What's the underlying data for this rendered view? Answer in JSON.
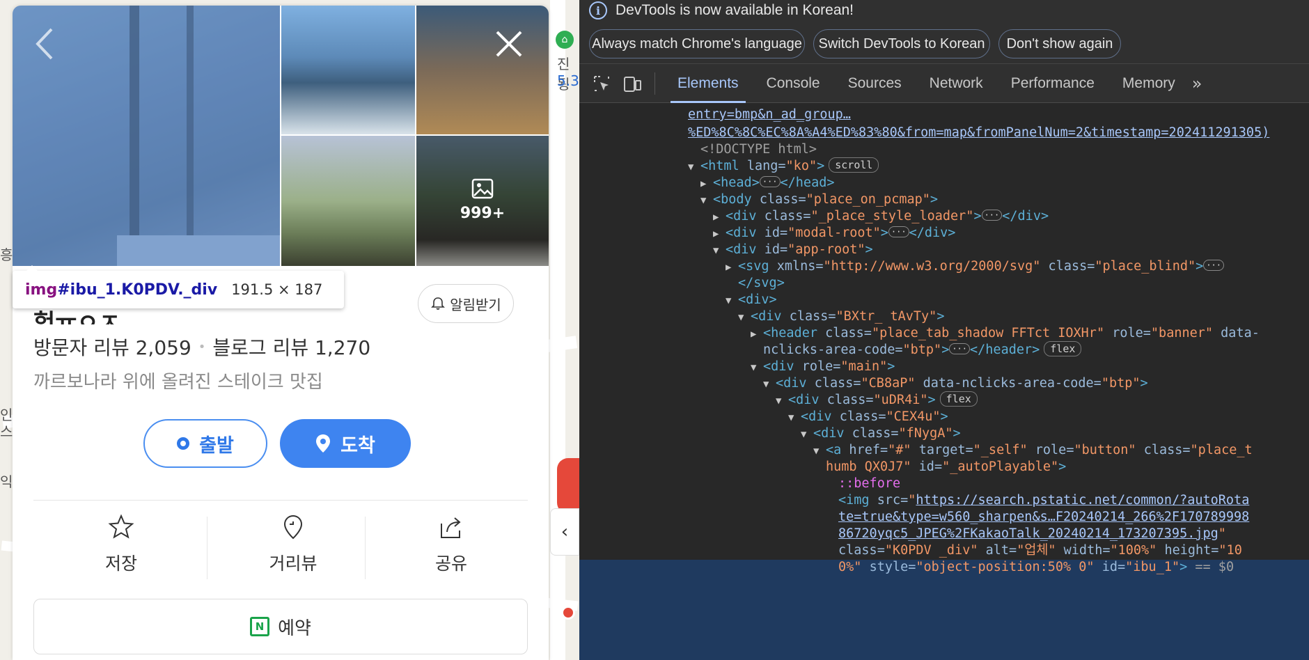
{
  "map": {
    "labels": [
      "진됭",
      "5.3r",
      "인",
      "스",
      "익",
      "흥"
    ]
  },
  "place": {
    "more_photos": "999+",
    "title_partial": "헝ㅠㅇㅈ",
    "alert_label": "알림받기",
    "visitor_review": "방문자 리뷰 2,059",
    "blog_review": "블로그 리뷰 1,270",
    "description": "까르보나라 위에 올려진 스테이크 맛집",
    "start_label": "출발",
    "arrive_label": "도착",
    "actions": {
      "save": "저장",
      "streetview": "거리뷰",
      "share": "공유"
    },
    "reserve_label": "예약",
    "collapse_glyph": "‹"
  },
  "inspector": {
    "tag": "img",
    "selector": "#ibu_1.K0PDV._div",
    "size": "191.5 × 187"
  },
  "devtools": {
    "banner_message": "DevTools is now available in Korean!",
    "banner_buttons": [
      "Always match Chrome's language",
      "Switch DevTools to Korean",
      "Don't show again"
    ],
    "tabs": [
      "Elements",
      "Console",
      "Sources",
      "Network",
      "Performance",
      "Memory"
    ],
    "active_tab": "Elements",
    "overflow": "»",
    "dom": {
      "url1": "entry=bmp&n_ad_group…",
      "url2": "%ED%8C%8C%EC%8A%A4%ED%83%80&from=map&fromPanelNum=2&timestamp=202411291305)",
      "doctype": "<!DOCTYPE html>",
      "html_lang": "\"ko\"",
      "scroll_badge": "scroll",
      "body_class": "\"place_on_pcmap\"",
      "div1_class": "\"_place_style_loader\"",
      "div2_id": "\"modal-root\"",
      "div3_id": "\"app-root\"",
      "svg_xmlns": "\"http://www.w3.org/2000/svg\"",
      "svg_class": "\"place_blind\"",
      "div_bxtr": "\"BXtr_ tAvTy\"",
      "header_class": "\"place_tab_shadow FFTct IOXHr\"",
      "header_role": "\"banner\"",
      "header_rest": "data-",
      "header_line2_attr": "nclicks-area-code=",
      "header_line2_val": "\"btp\"",
      "flex_badge": "flex",
      "main_role": "\"main\"",
      "cb8ap_class": "\"CB8aP\"",
      "cb8ap_attr": "data-nclicks-area-code=",
      "cb8ap_val": "\"btp\"",
      "udr4i_class": "\"uDR4i\"",
      "cex4u_class": "\"CEX4u\"",
      "fnyga_class": "\"fNygA\"",
      "a_href": "\"#\"",
      "a_target": "\"_self\"",
      "a_role": "\"button\"",
      "a_class_start": "\"place_t",
      "a_line2": "humb QX0J7\"",
      "a_id": "\"_autoPlayable\"",
      "before": "::before",
      "img_src1": "https://search.pstatic.net/common/?autoRota",
      "img_src2": "te=true&type=w560_sharpen&s…F20240214_266%2F170789998",
      "img_src3": "86720yqc5_JPEG%2FKakaoTalk_20240214_173207395.jpg",
      "img_class": "\"K0PDV _div\"",
      "img_alt": "\"업체\"",
      "img_width": "\"100%\"",
      "img_height": "\"10",
      "img_line5_start": "0%\"",
      "img_style": "\"object-position:50% 0\"",
      "img_id": "\"ibu_1\"",
      "img_eq": "== $0"
    }
  }
}
